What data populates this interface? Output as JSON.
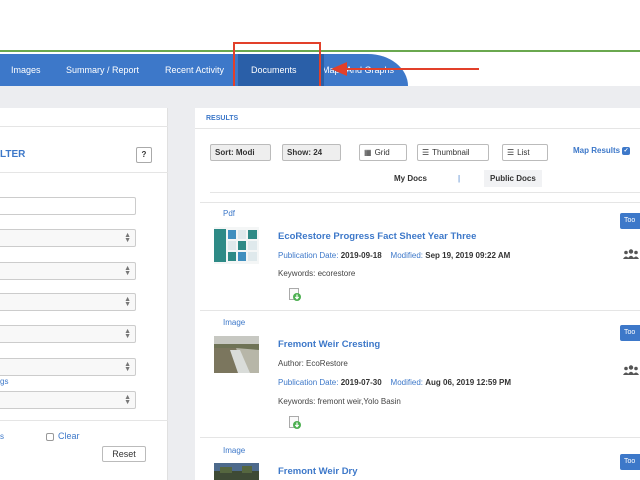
{
  "nav": {
    "items": [
      "Images",
      "Summary / Report",
      "Recent Activity"
    ],
    "active": "Documents",
    "overflow": "Maps And Graphs"
  },
  "filter": {
    "title": "LTER",
    "help": "?",
    "link_fragment": "gs",
    "bottom_fragment": "s",
    "clear": "Clear",
    "reset": "Reset"
  },
  "results": {
    "header": "RESULTS",
    "sort": "Sort: Modi",
    "show": "Show: 24",
    "grid": "Grid",
    "thumbnail": "Thumbnail",
    "list": "List",
    "map_results": "Map Results",
    "tab_mydocs": "My Docs",
    "tab_sep": "|",
    "tab_public": "Public Docs",
    "items": [
      {
        "type": "Pdf",
        "title": "EcoRestore Progress Fact Sheet Year Three",
        "pub_label": "Publication Date:",
        "pub_date": "2019-09-18",
        "mod_label": "Modified:",
        "mod_date": "Sep 19, 2019 09:22 AM",
        "keywords": "Keywords: ecorestore",
        "tag": "Too"
      },
      {
        "type": "Image",
        "title": "Fremont Weir Cresting",
        "author": "Author: EcoRestore",
        "pub_label": "Publication Date:",
        "pub_date": "2019-07-30",
        "mod_label": "Modified:",
        "mod_date": "Aug 06, 2019 12:59 PM",
        "keywords": "Keywords: fremont weir,Yolo Basin",
        "tag": "Too"
      },
      {
        "type": "Image",
        "title": "Fremont Weir Dry",
        "tag": "Too"
      }
    ]
  },
  "colors": {
    "accent": "#3d78c9",
    "nav_active": "#2a5fa8",
    "annotation": "#e2402a",
    "green_rule": "#6aa84f"
  },
  "icons": [
    "grid-icon",
    "list-icon",
    "download-icon",
    "users-icon",
    "checkbox-icon",
    "arrow-left-icon"
  ]
}
